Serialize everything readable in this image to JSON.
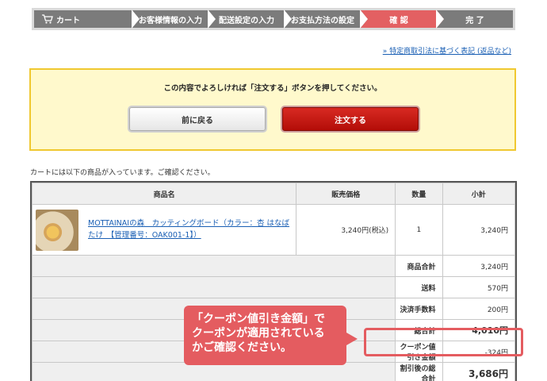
{
  "steps": [
    {
      "label": "カート",
      "active": false
    },
    {
      "label": "お客様情報の入力",
      "active": false
    },
    {
      "label": "配送設定の入力",
      "active": false
    },
    {
      "label": "お支払方法の設定",
      "active": false
    },
    {
      "label": "確 認",
      "active": true
    },
    {
      "label": "完 了",
      "active": false
    }
  ],
  "legal_link": "» 特定商取引法に基づく表記 (返品など)",
  "notice": {
    "text": "この内容でよろしければ「注文する」ボタンを押してください。",
    "back_label": "前に戻る",
    "order_label": "注文する"
  },
  "intro": "カートには以下の商品が入っています。ご確認ください。",
  "table": {
    "headers": {
      "name": "商品名",
      "price": "販売価格",
      "qty": "数量",
      "subtotal": "小計"
    },
    "item": {
      "name_line1": "MOTTAINAIの森　カッティングボード（カラー：杏 はなば",
      "name_line2": "たけ　【管理番号：OAK001-1】）",
      "price": "3,240円(税込)",
      "qty": "1",
      "subtotal": "3,240円"
    },
    "summary": [
      {
        "label": "商品合計",
        "value": "3,240円"
      },
      {
        "label": "送料",
        "value": "570円"
      },
      {
        "label": "決済手数料",
        "value": "200円"
      },
      {
        "label": "総合計",
        "value": "4,010円"
      },
      {
        "label": "クーポン値引き金額",
        "value": "-324円"
      },
      {
        "label": "割引後の総合計",
        "value": "3,686円"
      }
    ]
  },
  "callout": {
    "line1": "「クーポン値引き金額」で",
    "line2": "クーポンが適用されている",
    "line3": "かご確認ください。"
  },
  "colors": {
    "active_step": "#e36062",
    "order_button": "#c41a13",
    "callout": "#e45c60"
  }
}
